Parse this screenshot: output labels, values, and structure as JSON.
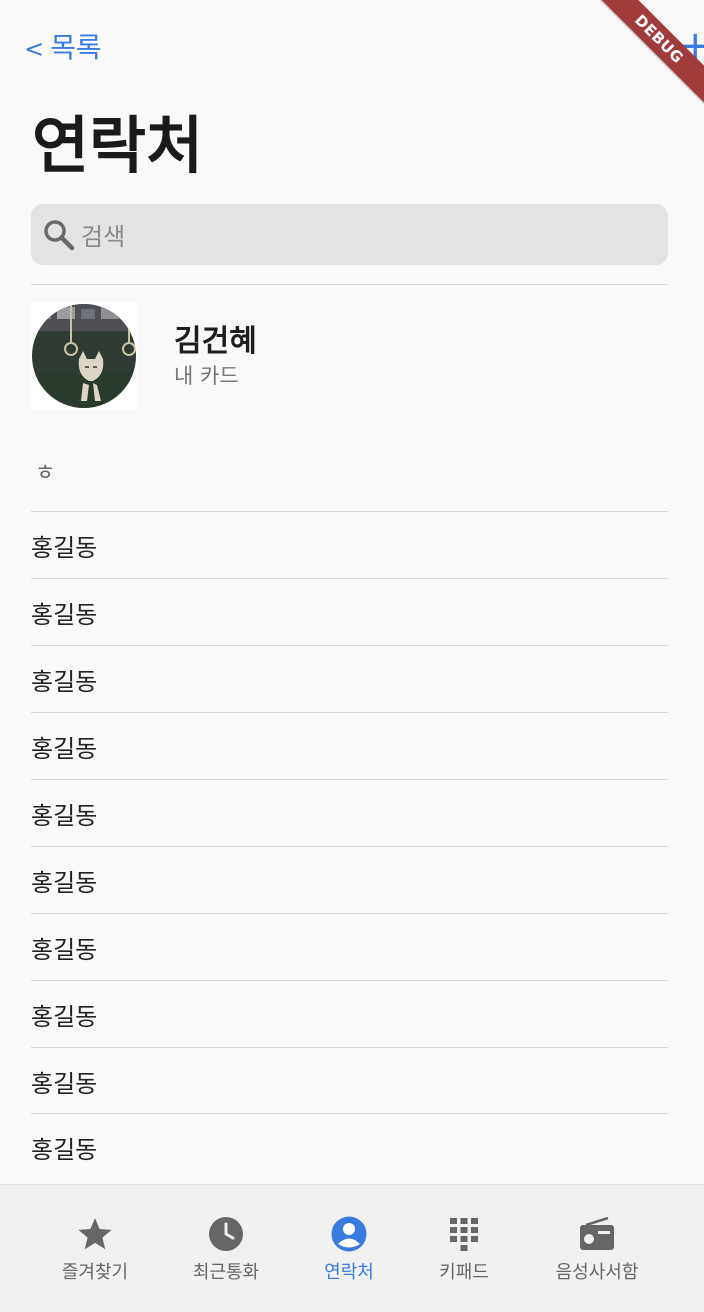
{
  "nav": {
    "back_label": "목록",
    "back_chevron": "<",
    "add_icon": "plus-icon"
  },
  "debug_banner": "DEBUG",
  "page_title": "연락처",
  "search": {
    "placeholder": "검색",
    "icon": "search-icon"
  },
  "my_card": {
    "name": "김건혜",
    "subtitle": "내 카드"
  },
  "section": {
    "letter": "ㅎ"
  },
  "contacts": [
    {
      "name": "홍길동"
    },
    {
      "name": "홍길동"
    },
    {
      "name": "홍길동"
    },
    {
      "name": "홍길동"
    },
    {
      "name": "홍길동"
    },
    {
      "name": "홍길동"
    },
    {
      "name": "홍길동"
    },
    {
      "name": "홍길동"
    },
    {
      "name": "홍길동"
    },
    {
      "name": "홍길동"
    }
  ],
  "tabs": [
    {
      "label": "즐겨찾기",
      "icon": "star-icon",
      "active": false
    },
    {
      "label": "최근통화",
      "icon": "clock-icon",
      "active": false
    },
    {
      "label": "연락처",
      "icon": "person-icon",
      "active": true
    },
    {
      "label": "키패드",
      "icon": "keypad-icon",
      "active": false
    },
    {
      "label": "음성사서함",
      "icon": "voicemail-radio-icon",
      "active": false
    }
  ],
  "colors": {
    "accent": "#3a7be0",
    "background": "#f9f9f9",
    "tabbar": "#f1f1f1",
    "search_bg": "#e3e3e3",
    "debug": "#a23b3b"
  }
}
